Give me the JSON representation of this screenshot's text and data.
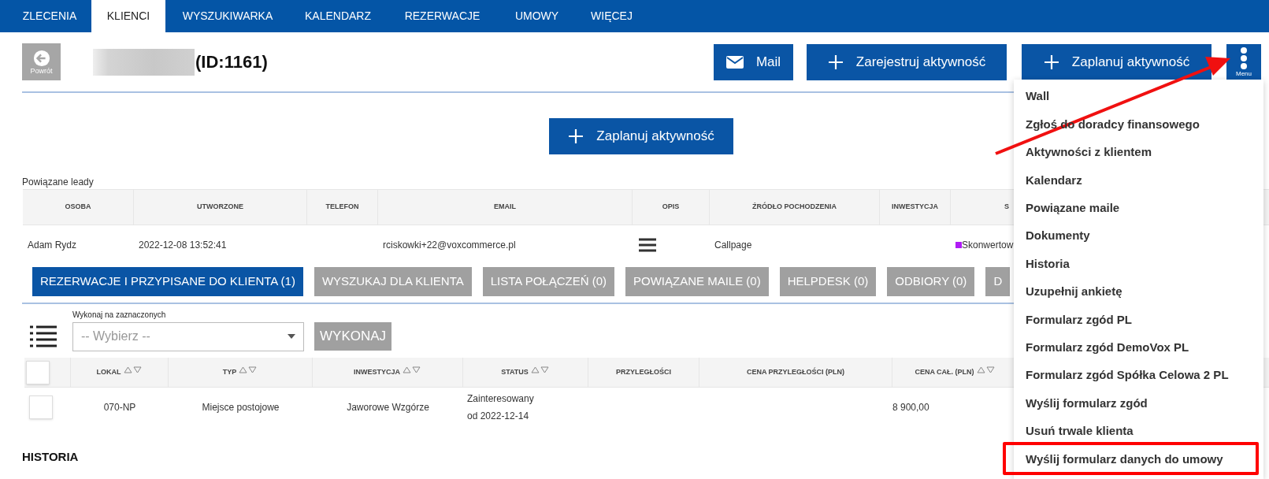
{
  "nav": [
    {
      "label": "ZLECENIA",
      "selected": false
    },
    {
      "label": "KLIENCI",
      "selected": true
    },
    {
      "label": "WYSZUKIWARKA",
      "selected": false
    },
    {
      "label": "KALENDARZ",
      "selected": false
    },
    {
      "label": "REZERWACJE",
      "selected": false
    },
    {
      "label": "UMOWY",
      "selected": false
    },
    {
      "label": "WIĘCEJ",
      "selected": false
    }
  ],
  "header": {
    "back_label": "Powrót",
    "client_id": "(ID:1161)",
    "name_redacted": true,
    "buttons": [
      {
        "kind": "mail",
        "label": "Mail"
      },
      {
        "kind": "plus",
        "label": "Zarejestruj aktywność"
      },
      {
        "kind": "plus",
        "label": "Zaplanuj aktywność"
      }
    ],
    "menu_button": "Menu"
  },
  "plan_button": "Zaplanuj aktywność",
  "leads": {
    "title": "Powiązane leady",
    "columns": [
      "OSOBA",
      "UTWORZONE",
      "TELEFON",
      "EMAIL",
      "OPIS",
      "ŹRÓDŁO POCHODZENIA",
      "INWESTYCJA",
      "S"
    ],
    "rows": [
      {
        "osoba": "Adam Rydz",
        "utworzone": "2022-12-08 13:52:41",
        "email": "rciskowki+22@voxcommerce.pl",
        "source": "Callpage",
        "status": {
          "text": "Skonwertow",
          "color": "#b01cf5"
        }
      }
    ]
  },
  "section_tabs": [
    {
      "label": "REZERWACJE I PRZYPISANE DO KLIENTA (1)",
      "selected": true
    },
    {
      "label": "WYSZUKAJ DLA KLIENTA",
      "selected": false
    },
    {
      "label": "LISTA POŁĄCZEŃ (0)",
      "selected": false
    },
    {
      "label": "POWIĄZANE MAILE (0)",
      "selected": false
    },
    {
      "label": "HELPDESK (0)",
      "selected": false
    },
    {
      "label": "ODBIORY (0)",
      "selected": false
    },
    {
      "label": "D",
      "selected": false
    }
  ],
  "bulk": {
    "label": "Wykonaj na zaznaczonych",
    "placeholder": "-- Wybierz --",
    "button": "WYKONAJ"
  },
  "reservations": {
    "select_all_checked": false,
    "columns": [
      {
        "label": "LOKAL",
        "sortable": true
      },
      {
        "label": "TYP",
        "sortable": true
      },
      {
        "label": "INWESTYCJA",
        "sortable": true
      },
      {
        "label": "STATUS",
        "sortable": true
      },
      {
        "label": "PRZYLEGŁOŚCI",
        "sortable": false
      },
      {
        "label": "CENA PRZYLEGŁOŚCI (PLN)",
        "sortable": false
      },
      {
        "label": "CENA CAŁ. (PLN)",
        "sortable": true
      }
    ],
    "rows": [
      {
        "checked": false,
        "lokal": "070-NP",
        "typ": "Miejsce postojowe",
        "inwestycja": "Jaworowe Wzgórze",
        "status": "Zainteresowany",
        "status_since": "od 2022-12-14",
        "cena_przyleglosci": "",
        "cena": "8 900,00"
      }
    ]
  },
  "history_title": "HISTORIA",
  "menu": [
    {
      "label": "Wall",
      "highlighted": false
    },
    {
      "label": "Zgłoś do doradcy finansowego",
      "highlighted": false
    },
    {
      "label": "Aktywności z klientem",
      "highlighted": false
    },
    {
      "label": "Kalendarz",
      "highlighted": false
    },
    {
      "label": "Powiązane maile",
      "highlighted": false
    },
    {
      "label": "Dokumenty",
      "highlighted": false
    },
    {
      "label": "Historia",
      "highlighted": false
    },
    {
      "label": "Uzupełnij ankietę",
      "highlighted": false
    },
    {
      "label": "Formularz zgód PL",
      "highlighted": false
    },
    {
      "label": "Formularz zgód DemoVox PL",
      "highlighted": false
    },
    {
      "label": "Formularz zgód Spółka Celowa 2 PL",
      "highlighted": false
    },
    {
      "label": "Wyślij formularz zgód",
      "highlighted": false
    },
    {
      "label": "Usuń trwale klienta",
      "highlighted": false
    },
    {
      "label": "Wyślij formularz danych do umowy",
      "highlighted": true
    }
  ]
}
